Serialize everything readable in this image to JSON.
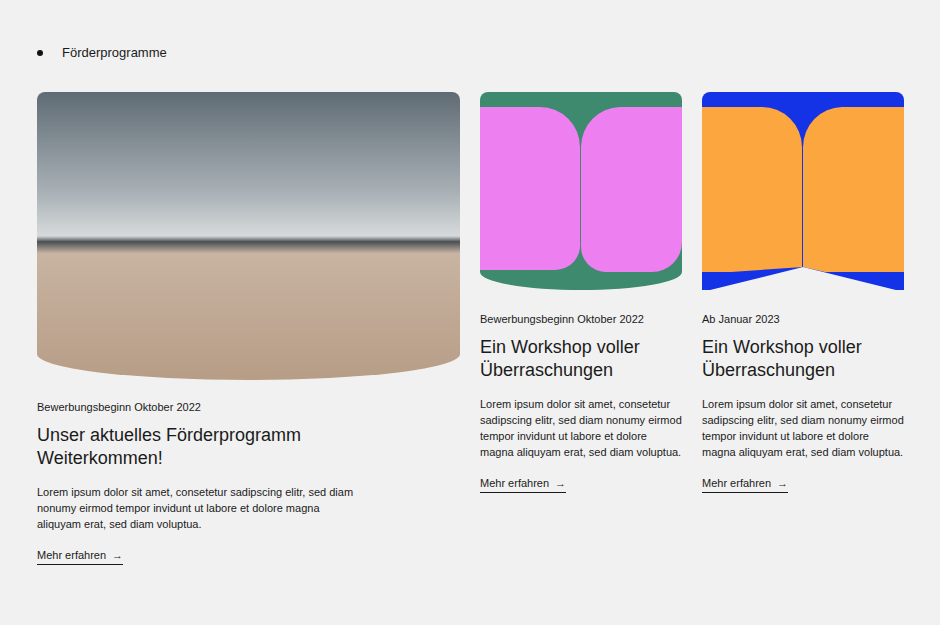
{
  "section": {
    "label": "Förderprogramme"
  },
  "cards": [
    {
      "kind": "photo",
      "date": "Bewerbungsbeginn Oktober 2022",
      "title": "Unser aktuelles Förderprogramm Weiterkommen!",
      "body": "Lorem ipsum dolor sit amet, consetetur sadipscing elitr, sed diam nonumy eirmod tempor invidunt ut labore et dolore magna aliquyam erat, sed diam voluptua.",
      "link": "Mehr erfahren",
      "arrow": "→"
    },
    {
      "kind": "arch",
      "color": "#ee7ff0",
      "ground": "#3d8a6f",
      "date": "Bewerbungsbeginn Oktober 2022",
      "title": "Ein Workshop voller Überraschungen",
      "body": "Lorem ipsum dolor sit amet, consetetur sadipscing elitr, sed diam nonumy eirmod tempor invidunt ut labore et dolore magna aliquyam erat, sed diam voluptua.",
      "link": "Mehr erfahren",
      "arrow": "→"
    },
    {
      "kind": "notch",
      "color": "#fca63f",
      "ground": "#1432e6",
      "date": "Ab Januar 2023",
      "title": "Ein Workshop voller Überraschungen",
      "body": "Lorem ipsum dolor sit amet, consetetur sadipscing elitr, sed diam nonumy eirmod tempor invidunt ut labore et dolore magna aliquyam erat, sed diam voluptua.",
      "link": "Mehr erfahren",
      "arrow": "→"
    }
  ]
}
